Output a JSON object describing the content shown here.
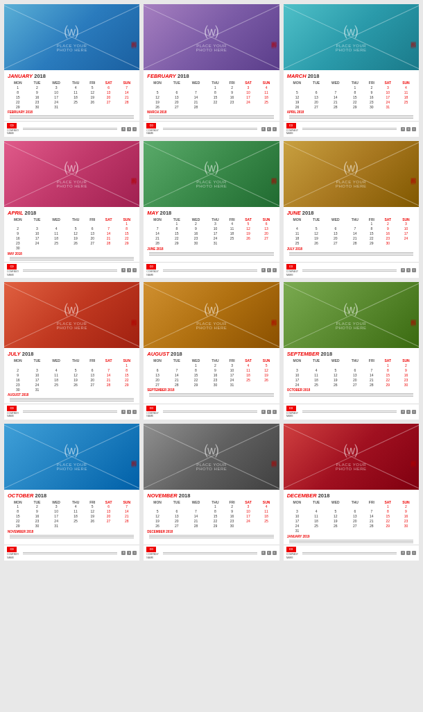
{
  "months": [
    {
      "name": "JANUARY",
      "year": "2018",
      "bg": "bg-blue",
      "headers": [
        "MON",
        "TUE",
        "WED",
        "THU",
        "FRI",
        "SAT",
        "SUN"
      ],
      "weeks": [
        [
          "1",
          "2",
          "3",
          "4",
          "5",
          "6",
          "7"
        ],
        [
          "8",
          "9",
          "10",
          "11",
          "12",
          "13",
          "14"
        ],
        [
          "15",
          "16",
          "17",
          "18",
          "19",
          "20",
          "21"
        ],
        [
          "22",
          "23",
          "24",
          "25",
          "26",
          "27",
          "28"
        ],
        [
          "29",
          "30",
          "31",
          "",
          "",
          "",
          ""
        ]
      ],
      "red_days": [
        6,
        7,
        13,
        14,
        20,
        21,
        27,
        28
      ],
      "next_name": "FEBRUARY 2018",
      "next_mini": true
    },
    {
      "name": "FEBRUARY",
      "year": "2018",
      "bg": "bg-purple",
      "headers": [
        "MON",
        "TUE",
        "WED",
        "THU",
        "FRI",
        "SAT",
        "SUN"
      ],
      "weeks": [
        [
          "",
          "",
          "",
          "1",
          "2",
          "3",
          "4"
        ],
        [
          "5",
          "6",
          "7",
          "8",
          "9",
          "10",
          "11"
        ],
        [
          "12",
          "13",
          "14",
          "15",
          "16",
          "17",
          "18"
        ],
        [
          "19",
          "20",
          "21",
          "22",
          "23",
          "24",
          "25"
        ],
        [
          "26",
          "27",
          "28",
          "",
          "",
          "",
          ""
        ]
      ],
      "red_days": [
        3,
        4,
        10,
        11,
        17,
        18,
        24,
        25
      ],
      "next_name": "MARCH 2018",
      "next_mini": true
    },
    {
      "name": "MARCH",
      "year": "2018",
      "bg": "bg-teal",
      "headers": [
        "MON",
        "TUE",
        "WED",
        "THU",
        "FRI",
        "SAT",
        "SUN"
      ],
      "weeks": [
        [
          "",
          "",
          "",
          "1",
          "2",
          "3",
          "4"
        ],
        [
          "5",
          "6",
          "7",
          "8",
          "9",
          "10",
          "11"
        ],
        [
          "12",
          "13",
          "14",
          "15",
          "16",
          "17",
          "18"
        ],
        [
          "19",
          "20",
          "21",
          "22",
          "23",
          "24",
          "25"
        ],
        [
          "26",
          "27",
          "28",
          "29",
          "30",
          "31",
          ""
        ]
      ],
      "red_days": [
        3,
        4,
        10,
        11,
        17,
        18,
        24,
        25,
        31
      ],
      "next_name": "APRIL 2018",
      "next_mini": true
    },
    {
      "name": "APRIL",
      "year": "2018",
      "bg": "bg-pink",
      "headers": [
        "MON",
        "TUE",
        "WED",
        "THU",
        "FRI",
        "SAT",
        "SUN"
      ],
      "weeks": [
        [
          "",
          "",
          "",
          "",
          "",
          "",
          "1"
        ],
        [
          "2",
          "3",
          "4",
          "5",
          "6",
          "7",
          "8"
        ],
        [
          "9",
          "10",
          "11",
          "12",
          "13",
          "14",
          "15"
        ],
        [
          "16",
          "17",
          "18",
          "19",
          "20",
          "21",
          "22"
        ],
        [
          "23",
          "24",
          "25",
          "26",
          "27",
          "28",
          "29"
        ],
        [
          "30",
          "",
          "",
          "",
          "",
          "",
          ""
        ]
      ],
      "red_days": [
        1,
        7,
        8,
        14,
        15,
        21,
        22,
        28,
        29
      ],
      "next_name": "MAY 2018",
      "next_mini": true
    },
    {
      "name": "MAY",
      "year": "2018",
      "bg": "bg-green",
      "headers": [
        "MON",
        "TUE",
        "WED",
        "THU",
        "FRI",
        "SAT",
        "SUN"
      ],
      "weeks": [
        [
          "",
          "1",
          "2",
          "3",
          "4",
          "5",
          "6"
        ],
        [
          "7",
          "8",
          "9",
          "10",
          "11",
          "12",
          "13"
        ],
        [
          "14",
          "15",
          "16",
          "17",
          "18",
          "19",
          "20"
        ],
        [
          "21",
          "22",
          "23",
          "24",
          "25",
          "26",
          "27"
        ],
        [
          "28",
          "29",
          "30",
          "31",
          "",
          "",
          ""
        ]
      ],
      "red_days": [
        5,
        6,
        12,
        13,
        19,
        20,
        26,
        27
      ],
      "next_name": "JUNE 2018",
      "next_mini": true
    },
    {
      "name": "JUNE",
      "year": "2018",
      "bg": "bg-gold",
      "headers": [
        "MON",
        "TUE",
        "WED",
        "THU",
        "FRI",
        "SAT",
        "SUN"
      ],
      "weeks": [
        [
          "",
          "",
          "",
          "",
          "1",
          "2",
          "3"
        ],
        [
          "4",
          "5",
          "6",
          "7",
          "8",
          "9",
          "10"
        ],
        [
          "11",
          "12",
          "13",
          "14",
          "15",
          "16",
          "17"
        ],
        [
          "18",
          "19",
          "20",
          "21",
          "22",
          "23",
          "24"
        ],
        [
          "25",
          "26",
          "27",
          "28",
          "29",
          "30",
          ""
        ]
      ],
      "red_days": [
        2,
        3,
        9,
        10,
        16,
        17,
        23,
        24,
        30
      ],
      "next_name": "JULY 2018",
      "next_mini": true
    },
    {
      "name": "JULY",
      "year": "2018",
      "bg": "bg-orange-red",
      "headers": [
        "MON",
        "TUE",
        "WED",
        "THU",
        "FRI",
        "SAT",
        "SUN"
      ],
      "weeks": [
        [
          "",
          "",
          "",
          "",
          "",
          "",
          "1"
        ],
        [
          "2",
          "3",
          "4",
          "5",
          "6",
          "7",
          "8"
        ],
        [
          "9",
          "10",
          "11",
          "12",
          "13",
          "14",
          "15"
        ],
        [
          "16",
          "17",
          "18",
          "19",
          "20",
          "21",
          "22"
        ],
        [
          "23",
          "24",
          "25",
          "26",
          "27",
          "28",
          "29"
        ],
        [
          "30",
          "31",
          "",
          "",
          "",
          "",
          ""
        ]
      ],
      "red_days": [
        1,
        7,
        8,
        14,
        15,
        21,
        22,
        28,
        29
      ],
      "next_name": "AUGUST 2018",
      "next_mini": true
    },
    {
      "name": "AUGUST",
      "year": "2018",
      "bg": "bg-amber",
      "headers": [
        "MON",
        "TUE",
        "WED",
        "THU",
        "FRI",
        "SAT",
        "SUN"
      ],
      "weeks": [
        [
          "",
          "",
          "1",
          "2",
          "3",
          "4",
          "5"
        ],
        [
          "6",
          "7",
          "8",
          "9",
          "10",
          "11",
          "12"
        ],
        [
          "13",
          "14",
          "15",
          "16",
          "17",
          "18",
          "19"
        ],
        [
          "20",
          "21",
          "22",
          "23",
          "24",
          "25",
          "26"
        ],
        [
          "27",
          "28",
          "29",
          "30",
          "31",
          "",
          ""
        ]
      ],
      "red_days": [
        4,
        5,
        11,
        12,
        18,
        19,
        25,
        26
      ],
      "next_name": "SEPTEMBER 2018",
      "next_mini": true
    },
    {
      "name": "SEPTEMBER",
      "year": "2018",
      "bg": "bg-olive",
      "headers": [
        "MON",
        "TUE",
        "WED",
        "THU",
        "FRI",
        "SAT",
        "SUN"
      ],
      "weeks": [
        [
          "",
          "",
          "",
          "",
          "",
          "1",
          "2"
        ],
        [
          "3",
          "4",
          "5",
          "6",
          "7",
          "8",
          "9"
        ],
        [
          "10",
          "11",
          "12",
          "13",
          "14",
          "15",
          "16"
        ],
        [
          "17",
          "18",
          "19",
          "20",
          "21",
          "22",
          "23"
        ],
        [
          "24",
          "25",
          "26",
          "27",
          "28",
          "29",
          "30"
        ]
      ],
      "red_days": [
        1,
        2,
        8,
        9,
        15,
        16,
        22,
        23,
        29,
        30
      ],
      "next_name": "OCTOBER 2018",
      "next_mini": true
    },
    {
      "name": "OCTOBER",
      "year": "2018",
      "bg": "bg-sky",
      "headers": [
        "MON",
        "TUE",
        "WED",
        "THU",
        "FRI",
        "SAT",
        "SUN"
      ],
      "weeks": [
        [
          "1",
          "2",
          "3",
          "4",
          "5",
          "6",
          "7"
        ],
        [
          "8",
          "9",
          "10",
          "11",
          "12",
          "13",
          "14"
        ],
        [
          "15",
          "16",
          "17",
          "18",
          "19",
          "20",
          "21"
        ],
        [
          "22",
          "23",
          "24",
          "25",
          "26",
          "27",
          "28"
        ],
        [
          "29",
          "30",
          "31",
          "",
          "",
          "",
          ""
        ]
      ],
      "red_days": [
        6,
        7,
        13,
        14,
        20,
        21,
        27,
        28
      ],
      "next_name": "NOVEMBER 2018",
      "next_mini": true
    },
    {
      "name": "NOVEMBER",
      "year": "2018",
      "bg": "bg-slate",
      "headers": [
        "MON",
        "TUE",
        "WED",
        "THU",
        "FRI",
        "SAT",
        "SUN"
      ],
      "weeks": [
        [
          "",
          "",
          "",
          "1",
          "2",
          "3",
          "4"
        ],
        [
          "5",
          "6",
          "7",
          "8",
          "9",
          "10",
          "11"
        ],
        [
          "12",
          "13",
          "14",
          "15",
          "16",
          "17",
          "18"
        ],
        [
          "19",
          "20",
          "21",
          "22",
          "23",
          "24",
          "25"
        ],
        [
          "26",
          "27",
          "28",
          "29",
          "30",
          "",
          ""
        ]
      ],
      "red_days": [
        3,
        4,
        10,
        11,
        17,
        18,
        24,
        25
      ],
      "next_name": "DECEMBER 2018",
      "next_mini": true
    },
    {
      "name": "DECEMBER",
      "year": "2018",
      "bg": "bg-crimson",
      "headers": [
        "MON",
        "TUE",
        "WED",
        "THU",
        "FRI",
        "SAT",
        "SUN"
      ],
      "weeks": [
        [
          "",
          "",
          "",
          "",
          "",
          "1",
          "2"
        ],
        [
          "3",
          "4",
          "5",
          "6",
          "7",
          "8",
          "9"
        ],
        [
          "10",
          "11",
          "12",
          "13",
          "14",
          "15",
          "16"
        ],
        [
          "17",
          "18",
          "19",
          "20",
          "21",
          "22",
          "23"
        ],
        [
          "24",
          "25",
          "26",
          "27",
          "28",
          "29",
          "30"
        ],
        [
          "31",
          "",
          "",
          "",
          "",
          "",
          ""
        ]
      ],
      "red_days": [
        1,
        2,
        8,
        9,
        15,
        16,
        22,
        23,
        29,
        30
      ],
      "next_name": "JANUARY 2019",
      "next_mini": true
    }
  ],
  "photo_text": "PLACE YOUR",
  "photo_text2": "PHOTO HERE",
  "company_name": "COMPANY",
  "company_name2": "NAME",
  "watermark": "新图网"
}
